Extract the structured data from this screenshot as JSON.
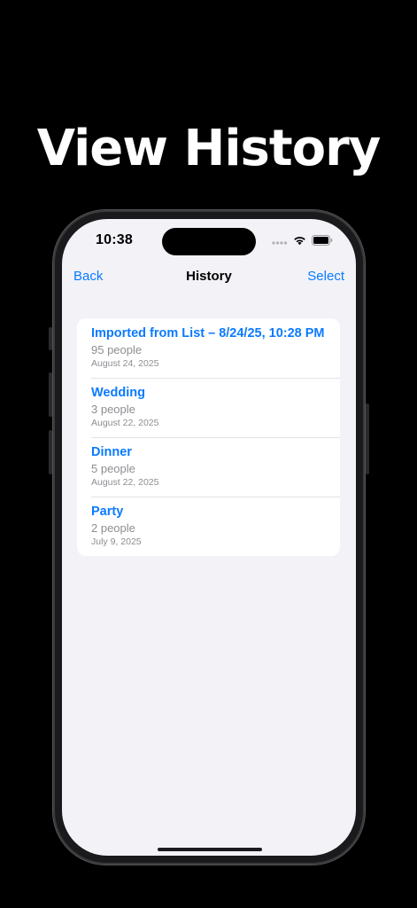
{
  "headline": "View History",
  "status_bar": {
    "time": "10:38"
  },
  "nav": {
    "back_label": "Back",
    "title": "History",
    "select_label": "Select"
  },
  "history": [
    {
      "title": "Imported from List – 8/24/25, 10:28 PM",
      "count": "95 people",
      "date": "August 24, 2025"
    },
    {
      "title": "Wedding",
      "count": "3 people",
      "date": "August 22, 2025"
    },
    {
      "title": "Dinner",
      "count": "5 people",
      "date": "August 22, 2025"
    },
    {
      "title": "Party",
      "count": "2 people",
      "date": "July 9, 2025"
    }
  ],
  "colors": {
    "accent": "#0a7aff",
    "background": "#f2f2f7",
    "secondary_text": "#8e8e93"
  }
}
